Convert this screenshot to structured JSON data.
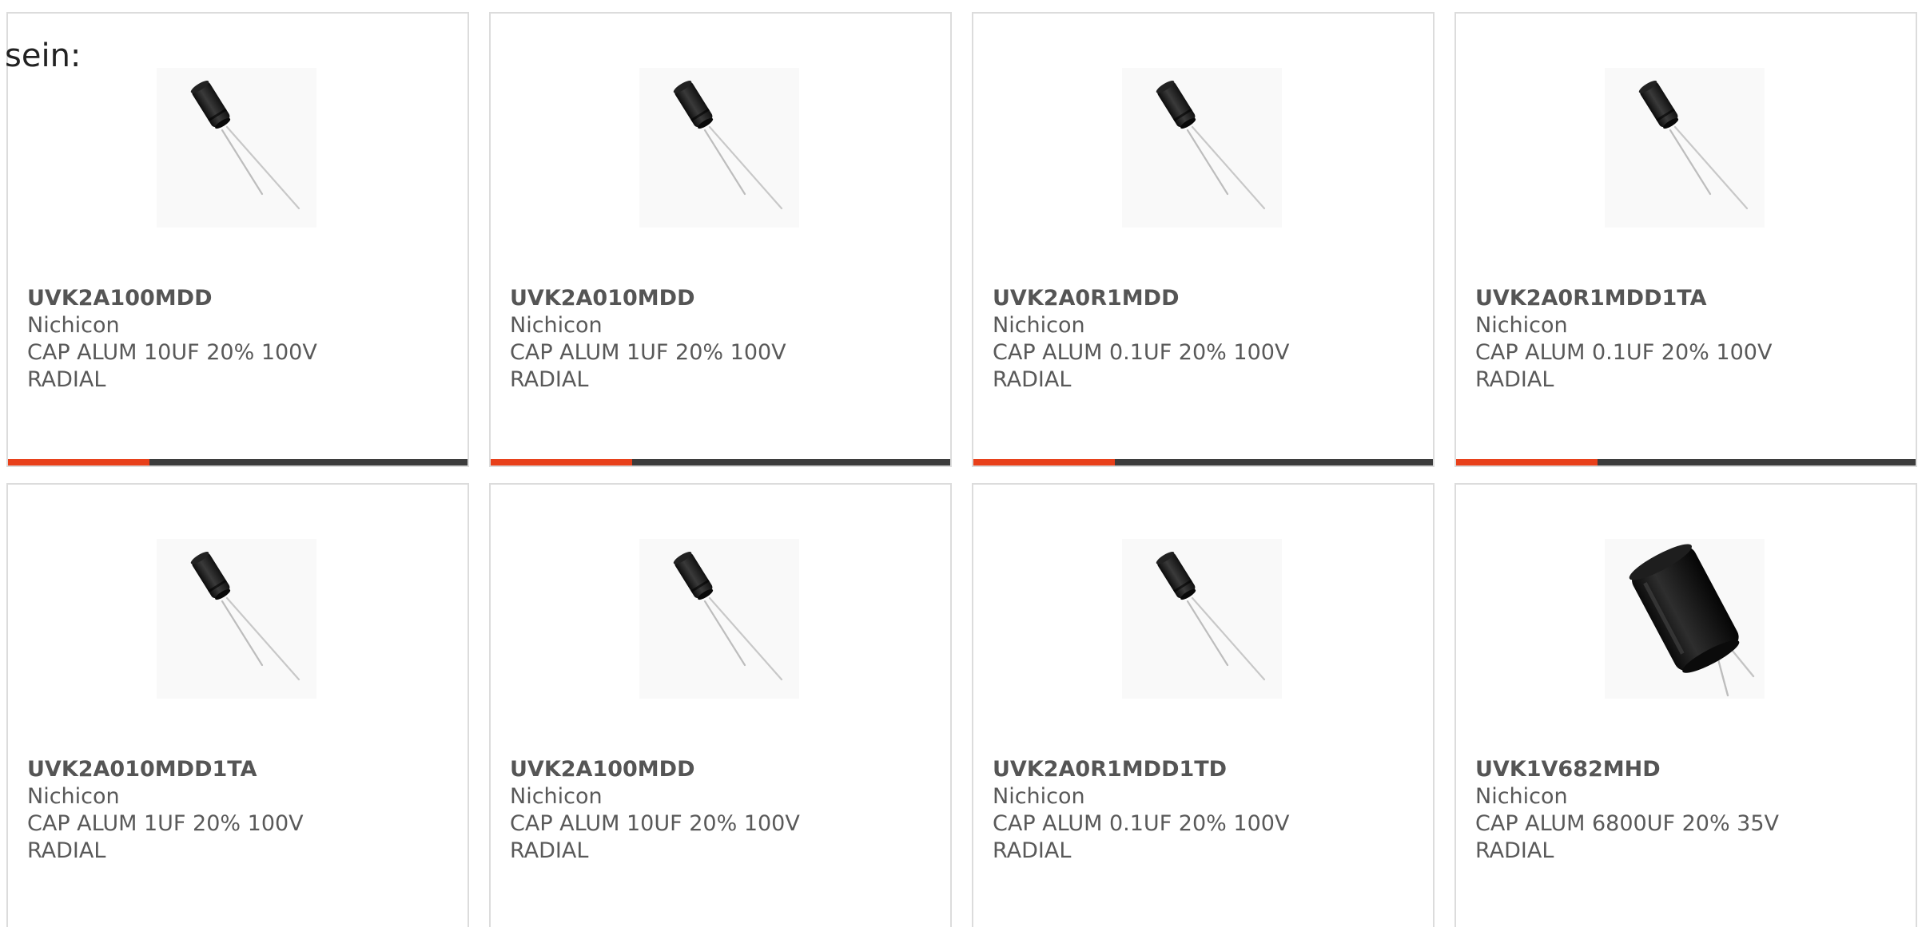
{
  "intro_text": "sein:",
  "colors": {
    "accent": "#e8401a",
    "bar_track": "#3c3c3c",
    "card_border": "#dcdcdc"
  },
  "products": [
    {
      "part": "UVK2A100MDD",
      "maker": "Nichicon",
      "desc": "CAP ALUM 10UF 20% 100V",
      "pkg": "RADIAL",
      "image": "small-radial-capacitor",
      "bar": true
    },
    {
      "part": "UVK2A010MDD",
      "maker": "Nichicon",
      "desc": "CAP ALUM 1UF 20% 100V",
      "pkg": "RADIAL",
      "image": "small-radial-capacitor",
      "bar": true
    },
    {
      "part": "UVK2A0R1MDD",
      "maker": "Nichicon",
      "desc": "CAP ALUM 0.1UF 20% 100V",
      "pkg": "RADIAL",
      "image": "small-radial-capacitor",
      "bar": true
    },
    {
      "part": "UVK2A0R1MDD1TA",
      "maker": "Nichicon",
      "desc": "CAP ALUM 0.1UF 20% 100V",
      "pkg": "RADIAL",
      "image": "small-radial-capacitor",
      "bar": true
    },
    {
      "part": "UVK2A010MDD1TA",
      "maker": "Nichicon",
      "desc": "CAP ALUM 1UF 20% 100V",
      "pkg": "RADIAL",
      "image": "small-radial-capacitor",
      "bar": false
    },
    {
      "part": "UVK2A100MDD",
      "maker": "Nichicon",
      "desc": "CAP ALUM 10UF 20% 100V",
      "pkg": "RADIAL",
      "image": "small-radial-capacitor",
      "bar": false
    },
    {
      "part": "UVK2A0R1MDD1TD",
      "maker": "Nichicon",
      "desc": "CAP ALUM 0.1UF 20% 100V",
      "pkg": "RADIAL",
      "image": "small-radial-capacitor",
      "bar": false
    },
    {
      "part": "UVK1V682MHD",
      "maker": "Nichicon",
      "desc": "CAP ALUM 6800UF 20% 35V",
      "pkg": "RADIAL",
      "image": "large-radial-capacitor",
      "bar": false
    }
  ]
}
